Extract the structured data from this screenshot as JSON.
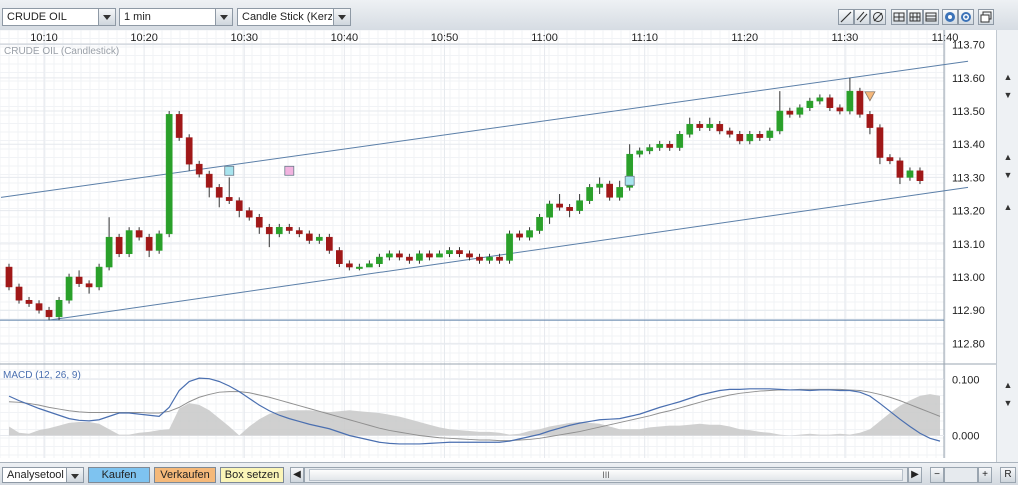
{
  "toolbar": {
    "instrument": "CRUDE OIL",
    "interval": "1 min",
    "chart_type": "Candle Stick (Kerze"
  },
  "chart_label": "CRUDE OIL (Candlestick)",
  "macd_label": "MACD (12, 26, 9)",
  "bottom": {
    "analysis_tool": "Analysetool",
    "buy": "Kaufen",
    "sell": "Verkaufen",
    "box": "Box setzen",
    "scroll_grip": "III",
    "r_label": "R",
    "minus": "−",
    "plus": "+"
  },
  "colors": {
    "up": "#2aa02a",
    "down": "#a01818",
    "grid": "#e6e9ee",
    "channel": "#5b7fa8",
    "macd": "#4a6fb0",
    "signal": "#909090",
    "hist": "#c8c8c8"
  },
  "chart_data": [
    {
      "type": "candlestick",
      "title": "CRUDE OIL (Candlestick)",
      "x_tick_labels": [
        "10:10",
        "10:20",
        "10:30",
        "10:40",
        "10:50",
        "11:00",
        "11:10",
        "11:20",
        "11:30",
        "11:40"
      ],
      "y_tick_labels": [
        "113.70",
        "113.60",
        "113.50",
        "113.40",
        "113.30",
        "113.20",
        "113.10",
        "113.00",
        "112.90",
        "112.80"
      ],
      "ylim": [
        112.75,
        113.72
      ],
      "grid": true,
      "candles": [
        [
          113.03,
          112.97,
          113.04,
          112.96
        ],
        [
          112.97,
          112.93,
          112.98,
          112.92
        ],
        [
          112.93,
          112.92,
          112.94,
          112.91
        ],
        [
          112.92,
          112.9,
          112.93,
          112.89
        ],
        [
          112.9,
          112.88,
          112.91,
          112.87
        ],
        [
          112.88,
          112.93,
          112.94,
          112.87
        ],
        [
          112.93,
          113.0,
          113.01,
          112.92
        ],
        [
          113.0,
          112.98,
          113.02,
          112.97
        ],
        [
          112.98,
          112.97,
          112.99,
          112.95
        ],
        [
          112.97,
          113.03,
          113.04,
          112.96
        ],
        [
          113.03,
          113.12,
          113.18,
          113.02
        ],
        [
          113.12,
          113.07,
          113.13,
          113.06
        ],
        [
          113.07,
          113.14,
          113.15,
          113.06
        ],
        [
          113.14,
          113.12,
          113.15,
          113.11
        ],
        [
          113.12,
          113.08,
          113.13,
          113.06
        ],
        [
          113.08,
          113.13,
          113.14,
          113.07
        ],
        [
          113.13,
          113.49,
          113.5,
          113.12
        ],
        [
          113.49,
          113.42,
          113.5,
          113.41
        ],
        [
          113.42,
          113.34,
          113.43,
          113.32
        ],
        [
          113.34,
          113.31,
          113.35,
          113.3
        ],
        [
          113.31,
          113.27,
          113.32,
          113.24
        ],
        [
          113.27,
          113.24,
          113.28,
          113.21
        ],
        [
          113.24,
          113.23,
          113.3,
          113.22
        ],
        [
          113.23,
          113.2,
          113.24,
          113.18
        ],
        [
          113.2,
          113.18,
          113.21,
          113.17
        ],
        [
          113.18,
          113.15,
          113.19,
          113.13
        ],
        [
          113.15,
          113.13,
          113.16,
          113.09
        ],
        [
          113.13,
          113.15,
          113.16,
          113.12
        ],
        [
          113.15,
          113.14,
          113.16,
          113.13
        ],
        [
          113.14,
          113.13,
          113.15,
          113.12
        ],
        [
          113.13,
          113.11,
          113.14,
          113.1
        ],
        [
          113.11,
          113.12,
          113.13,
          113.1
        ],
        [
          113.12,
          113.08,
          113.13,
          113.07
        ],
        [
          113.08,
          113.04,
          113.09,
          113.03
        ],
        [
          113.04,
          113.03,
          113.05,
          113.02
        ],
        [
          113.03,
          113.03,
          113.04,
          113.02
        ],
        [
          113.03,
          113.04,
          113.05,
          113.03
        ],
        [
          113.04,
          113.06,
          113.07,
          113.03
        ],
        [
          113.06,
          113.07,
          113.08,
          113.05
        ],
        [
          113.07,
          113.06,
          113.08,
          113.05
        ],
        [
          113.06,
          113.05,
          113.07,
          113.04
        ],
        [
          113.05,
          113.07,
          113.08,
          113.04
        ],
        [
          113.07,
          113.06,
          113.08,
          113.05
        ],
        [
          113.06,
          113.07,
          113.08,
          113.06
        ],
        [
          113.07,
          113.08,
          113.09,
          113.06
        ],
        [
          113.08,
          113.07,
          113.09,
          113.06
        ],
        [
          113.07,
          113.06,
          113.08,
          113.05
        ],
        [
          113.06,
          113.05,
          113.07,
          113.04
        ],
        [
          113.05,
          113.06,
          113.07,
          113.04
        ],
        [
          113.06,
          113.05,
          113.07,
          113.04
        ],
        [
          113.05,
          113.13,
          113.14,
          113.04
        ],
        [
          113.13,
          113.12,
          113.14,
          113.11
        ],
        [
          113.12,
          113.14,
          113.15,
          113.11
        ],
        [
          113.14,
          113.18,
          113.19,
          113.13
        ],
        [
          113.18,
          113.22,
          113.23,
          113.16
        ],
        [
          113.22,
          113.21,
          113.25,
          113.2
        ],
        [
          113.21,
          113.2,
          113.22,
          113.18
        ],
        [
          113.2,
          113.23,
          113.25,
          113.19
        ],
        [
          113.23,
          113.27,
          113.28,
          113.22
        ],
        [
          113.27,
          113.28,
          113.3,
          113.25
        ],
        [
          113.28,
          113.24,
          113.29,
          113.23
        ],
        [
          113.24,
          113.27,
          113.29,
          113.23
        ],
        [
          113.27,
          113.37,
          113.4,
          113.26
        ],
        [
          113.37,
          113.38,
          113.39,
          113.36
        ],
        [
          113.38,
          113.39,
          113.4,
          113.37
        ],
        [
          113.39,
          113.4,
          113.41,
          113.38
        ],
        [
          113.4,
          113.39,
          113.41,
          113.38
        ],
        [
          113.39,
          113.43,
          113.44,
          113.38
        ],
        [
          113.43,
          113.46,
          113.48,
          113.42
        ],
        [
          113.46,
          113.45,
          113.47,
          113.44
        ],
        [
          113.45,
          113.46,
          113.48,
          113.44
        ],
        [
          113.46,
          113.44,
          113.47,
          113.43
        ],
        [
          113.44,
          113.43,
          113.45,
          113.42
        ],
        [
          113.43,
          113.41,
          113.44,
          113.4
        ],
        [
          113.41,
          113.43,
          113.44,
          113.4
        ],
        [
          113.43,
          113.42,
          113.44,
          113.41
        ],
        [
          113.42,
          113.44,
          113.45,
          113.41
        ],
        [
          113.44,
          113.5,
          113.56,
          113.43
        ],
        [
          113.5,
          113.49,
          113.51,
          113.48
        ],
        [
          113.49,
          113.51,
          113.52,
          113.48
        ],
        [
          113.51,
          113.53,
          113.54,
          113.5
        ],
        [
          113.53,
          113.54,
          113.55,
          113.52
        ],
        [
          113.54,
          113.51,
          113.55,
          113.5
        ],
        [
          113.51,
          113.5,
          113.52,
          113.49
        ],
        [
          113.5,
          113.56,
          113.6,
          113.49
        ],
        [
          113.56,
          113.49,
          113.57,
          113.48
        ],
        [
          113.49,
          113.45,
          113.5,
          113.43
        ],
        [
          113.45,
          113.36,
          113.46,
          113.34
        ],
        [
          113.36,
          113.35,
          113.37,
          113.34
        ],
        [
          113.35,
          113.3,
          113.36,
          113.28
        ],
        [
          113.3,
          113.32,
          113.33,
          113.29
        ],
        [
          113.32,
          113.29,
          113.33,
          113.28
        ]
      ],
      "channel_lines": [
        {
          "from": [
            0,
            113.24
          ],
          "to": [
            95,
            113.65
          ]
        },
        {
          "from": [
            4,
            112.87
          ],
          "to": [
            95,
            113.27
          ]
        }
      ],
      "horizontal_line": 112.87,
      "markers": [
        {
          "type": "square",
          "color": "#a8e4ee",
          "index": 22,
          "value": 113.32
        },
        {
          "type": "square",
          "color": "#f2b4e0",
          "index": 28,
          "value": 113.32
        },
        {
          "type": "square",
          "color": "#a8e4ee",
          "index": 62,
          "value": 113.29
        },
        {
          "type": "triangle",
          "color": "#f6b87a",
          "index": 86,
          "value": 113.54
        }
      ]
    },
    {
      "type": "line",
      "title": "MACD (12, 26, 9)",
      "y_tick_labels": [
        "0.100",
        "0.000"
      ],
      "ylim": [
        -0.04,
        0.12
      ],
      "series": [
        {
          "values": [
            0.07,
            0.062,
            0.055,
            0.048,
            0.042,
            0.036,
            0.03,
            0.027,
            0.026,
            0.028,
            0.034,
            0.04,
            0.04,
            0.038,
            0.036,
            0.034,
            0.05,
            0.08,
            0.096,
            0.102,
            0.101,
            0.096,
            0.088,
            0.078,
            0.066,
            0.054,
            0.044,
            0.036,
            0.03,
            0.025,
            0.02,
            0.016,
            0.012,
            0.006,
            0.0,
            -0.004,
            -0.008,
            -0.012,
            -0.014,
            -0.015,
            -0.015,
            -0.015,
            -0.014,
            -0.013,
            -0.012,
            -0.012,
            -0.012,
            -0.012,
            -0.012,
            -0.012,
            -0.01,
            -0.006,
            -0.002,
            0.002,
            0.008,
            0.013,
            0.018,
            0.022,
            0.025,
            0.028,
            0.029,
            0.03,
            0.034,
            0.038,
            0.044,
            0.05,
            0.055,
            0.06,
            0.066,
            0.072,
            0.076,
            0.08,
            0.082,
            0.082,
            0.083,
            0.083,
            0.083,
            0.082,
            0.081,
            0.081,
            0.08,
            0.081,
            0.081,
            0.08,
            0.08,
            0.077,
            0.07,
            0.057,
            0.043,
            0.029,
            0.016,
            0.004,
            -0.005,
            -0.01
          ]
        },
        {
          "values": [
            0.06,
            0.059,
            0.057,
            0.054,
            0.05,
            0.047,
            0.044,
            0.042,
            0.041,
            0.041,
            0.041,
            0.041,
            0.041,
            0.041,
            0.04,
            0.04,
            0.043,
            0.05,
            0.06,
            0.068,
            0.073,
            0.077,
            0.078,
            0.078,
            0.076,
            0.072,
            0.068,
            0.063,
            0.058,
            0.053,
            0.048,
            0.043,
            0.038,
            0.033,
            0.028,
            0.023,
            0.018,
            0.013,
            0.009,
            0.006,
            0.003,
            0.0,
            -0.002,
            -0.004,
            -0.005,
            -0.006,
            -0.007,
            -0.008,
            -0.008,
            -0.009,
            -0.009,
            -0.008,
            -0.007,
            -0.005,
            -0.002,
            0.001,
            0.004,
            0.007,
            0.011,
            0.015,
            0.019,
            0.023,
            0.027,
            0.031,
            0.035,
            0.04,
            0.044,
            0.049,
            0.054,
            0.059,
            0.064,
            0.068,
            0.072,
            0.075,
            0.077,
            0.079,
            0.08,
            0.081,
            0.081,
            0.082,
            0.082,
            0.082,
            0.082,
            0.082,
            0.081,
            0.08,
            0.077,
            0.073,
            0.068,
            0.062,
            0.055,
            0.048,
            0.041,
            0.034
          ]
        }
      ]
    }
  ]
}
